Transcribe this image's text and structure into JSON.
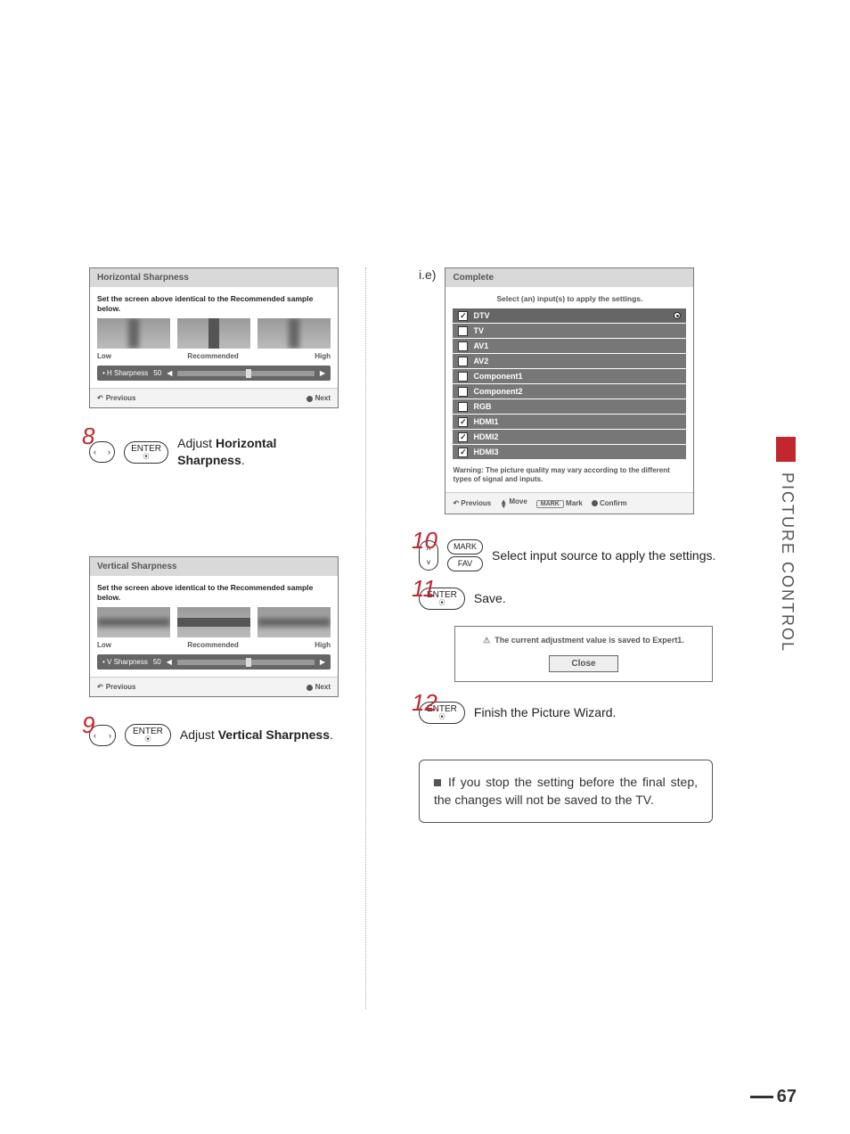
{
  "side_tab": "PICTURE CONTROL",
  "page_number": "67",
  "panel_h": {
    "title": "Horizontal Sharpness",
    "instruction": "Set the screen above identical to the Recommended sample below.",
    "labels": {
      "low": "Low",
      "rec": "Recommended",
      "high": "High"
    },
    "slider": {
      "name": "• H Sharpness",
      "value": "50"
    },
    "prev": "Previous",
    "next": "Next"
  },
  "panel_v": {
    "title": "Vertical Sharpness",
    "instruction": "Set the screen above identical to the Recommended sample below.",
    "labels": {
      "low": "Low",
      "rec": "Recommended",
      "high": "High"
    },
    "slider": {
      "name": "• V Sharpness",
      "value": "50"
    },
    "prev": "Previous",
    "next": "Next"
  },
  "step8": {
    "num": "8",
    "btn": "ENTER",
    "pre": "Adjust ",
    "bold": "Horizontal Sharpness",
    "post": "."
  },
  "step9": {
    "num": "9",
    "btn": "ENTER",
    "pre": "Adjust ",
    "bold": "Vertical Sharpness",
    "post": "."
  },
  "ie": "i.e)",
  "complete": {
    "title": "Complete",
    "select_text": "Select (an) input(s) to apply the settings.",
    "inputs": [
      {
        "label": "DTV",
        "checked": true,
        "highlight": true
      },
      {
        "label": "TV",
        "checked": false
      },
      {
        "label": "AV1",
        "checked": false
      },
      {
        "label": "AV2",
        "checked": false
      },
      {
        "label": "Component1",
        "checked": false
      },
      {
        "label": "Component2",
        "checked": false
      },
      {
        "label": "RGB",
        "checked": false
      },
      {
        "label": "HDMI1",
        "checked": true
      },
      {
        "label": "HDMI2",
        "checked": true
      },
      {
        "label": "HDMI3",
        "checked": true
      }
    ],
    "warning": "Warning: The picture quality may vary according to the different types of signal and inputs.",
    "footer": {
      "prev": "Previous",
      "move": "Move",
      "mark_btn": "MARK",
      "mark": "Mark",
      "confirm": "Confirm"
    }
  },
  "step10": {
    "num": "10",
    "btn1": "MARK",
    "btn2": "FAV",
    "text": "Select input source to apply the settings."
  },
  "step11": {
    "num": "11",
    "btn": "ENTER",
    "text": "Save."
  },
  "saved": {
    "msg": "The current adjustment value is saved to Expert1.",
    "close": "Close"
  },
  "step12": {
    "num": "12",
    "btn": "ENTER",
    "text": "Finish the Picture Wizard."
  },
  "note": "If you stop the setting before the final step, the changes will not be saved to the TV."
}
